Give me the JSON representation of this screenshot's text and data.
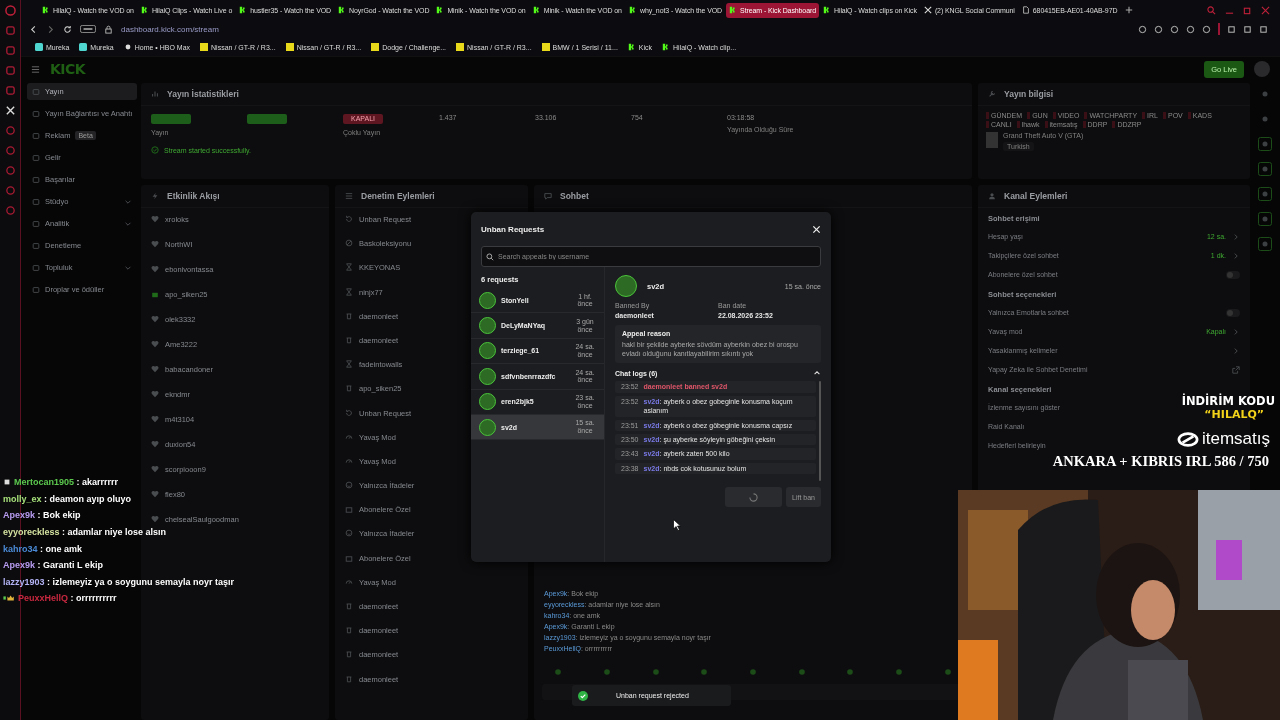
{
  "browser": {
    "tabs": [
      {
        "title": "HilalQ - Watch the VOD on",
        "kind": "kick",
        "selected": false
      },
      {
        "title": "HilalQ Clips - Watch Live o",
        "kind": "kick",
        "selected": false
      },
      {
        "title": "hustler35 - Watch the VOD",
        "kind": "kick",
        "selected": false
      },
      {
        "title": "NoyrGod - Watch the VOD",
        "kind": "kick",
        "selected": false
      },
      {
        "title": "Minik - Watch the VOD on",
        "kind": "kick",
        "selected": false
      },
      {
        "title": "Minik - Watch the VOD on",
        "kind": "kick",
        "selected": false
      },
      {
        "title": "why_not3 - Watch the VOD",
        "kind": "kick",
        "selected": false
      },
      {
        "title": "Stream - Kick Dashboard",
        "kind": "kick",
        "selected": true
      },
      {
        "title": "HilalQ - Watch clips on Kick",
        "kind": "kick",
        "selected": false
      },
      {
        "title": "(2) KNGL Social Communi",
        "kind": "x",
        "selected": false
      },
      {
        "title": "680415EB-AE01-40AB-97D",
        "kind": "file",
        "selected": false
      }
    ],
    "url": "dashboard.kick.com/stream",
    "bookmarks": [
      {
        "label": "Mureka",
        "kind": "mureka"
      },
      {
        "label": "Mureka",
        "kind": "mureka"
      },
      {
        "label": "Home • HBO Max",
        "kind": "dot"
      },
      {
        "label": "Nissan / GT-R / R3...",
        "kind": "s"
      },
      {
        "label": "Nissan / GT-R / R3...",
        "kind": "s"
      },
      {
        "label": "Dodge / Challenge...",
        "kind": "s"
      },
      {
        "label": "Nissan / GT-R / R3...",
        "kind": "s"
      },
      {
        "label": "BMW / 1 Serisi / 11...",
        "kind": "s"
      },
      {
        "label": "Kick",
        "kind": "kick"
      },
      {
        "label": "HilalQ - Watch clip...",
        "kind": "kick"
      }
    ]
  },
  "header": {
    "logo": "KICK",
    "go_live": "Go Live"
  },
  "nav": [
    {
      "label": "Yayın",
      "selected": true,
      "expandable": false
    },
    {
      "label": "Yayın Bağlantısı ve Anahtı",
      "selected": false,
      "expandable": false
    },
    {
      "label": "Reklam",
      "badge": "Beta",
      "selected": false,
      "expandable": false
    },
    {
      "label": "Gelir",
      "selected": false,
      "expandable": false
    },
    {
      "label": "Başarılar",
      "selected": false,
      "expandable": false
    },
    {
      "label": "Stüdyo",
      "selected": false,
      "expandable": true
    },
    {
      "label": "Analitik",
      "selected": false,
      "expandable": true
    },
    {
      "label": "Denetleme",
      "selected": false,
      "expandable": false
    },
    {
      "label": "Topluluk",
      "selected": false,
      "expandable": true
    },
    {
      "label": "Droplar ve ödüller",
      "selected": false,
      "expandable": false
    }
  ],
  "stats": {
    "title": "Yayın İstatistikleri",
    "items": [
      {
        "kind": "badge",
        "color": "#1d5e1a",
        "label": "Yayın"
      },
      {
        "kind": "badge",
        "color": "#1d5e1a"
      },
      {
        "kind": "badge",
        "color": "#5e1620",
        "value": "KAPALI",
        "label": "Çoklu Yayın"
      },
      {
        "kind": "number",
        "value": "1.437"
      },
      {
        "kind": "number",
        "value": "33.106"
      },
      {
        "kind": "number",
        "value": "754"
      },
      {
        "kind": "number",
        "value": "03:18:58",
        "label": "Yayında Olduğu Süre"
      }
    ],
    "status": "Stream started successfully."
  },
  "stream_info": {
    "title": "Yayın bilgisi",
    "tags": [
      "GÜNDEM",
      "GUN",
      "VIDEO",
      "WATCHPARTY",
      "IRL",
      "POV",
      "KADS",
      "CANLI",
      "lhawk",
      "itemsatış",
      "DDRP",
      "DDZRP"
    ],
    "category": "Grand Theft Auto V (GTA)",
    "language": "Turkish"
  },
  "activity": {
    "title": "Etkinlik Akışı",
    "items": [
      {
        "name": "xroloks",
        "kind": "follow"
      },
      {
        "name": "NorthWI",
        "kind": "follow"
      },
      {
        "name": "ebonivontassa",
        "kind": "follow"
      },
      {
        "name": "apo_siken25",
        "kind": "gift"
      },
      {
        "name": "olek3332",
        "kind": "follow"
      },
      {
        "name": "Ame3222",
        "kind": "follow"
      },
      {
        "name": "babacandoner",
        "kind": "follow"
      },
      {
        "name": "ekndmr",
        "kind": "follow"
      },
      {
        "name": "m4t3104",
        "kind": "follow"
      },
      {
        "name": "duxion54",
        "kind": "follow"
      },
      {
        "name": "scorpiooon9",
        "kind": "follow"
      },
      {
        "name": "flex80",
        "kind": "follow"
      },
      {
        "name": "chelsealSaulgoodman",
        "kind": "follow"
      }
    ]
  },
  "moderation": {
    "title": "Denetim Eylemleri",
    "items": [
      {
        "name": "Unban Request",
        "kind": "unban"
      },
      {
        "name": "Baskoleksiyonu",
        "kind": "ban"
      },
      {
        "name": "KKEYONAS",
        "kind": "timeout"
      },
      {
        "name": "ninjx77",
        "kind": "timeout"
      },
      {
        "name": "daemonleet",
        "kind": "delete"
      },
      {
        "name": "daemonleet",
        "kind": "delete"
      },
      {
        "name": "fadeintowalls",
        "kind": "timeout"
      },
      {
        "name": "apo_siken25",
        "kind": "delete"
      },
      {
        "name": "Unban Request",
        "kind": "unban"
      },
      {
        "name": "Yavaş Mod",
        "kind": "slow"
      },
      {
        "name": "Yavaş Mod",
        "kind": "slow"
      },
      {
        "name": "Yalnızca İfadeler",
        "kind": "emote"
      },
      {
        "name": "Abonelere Özel",
        "kind": "subs"
      },
      {
        "name": "Yalnızca İfadeler",
        "kind": "emote"
      },
      {
        "name": "Abonelere Özel",
        "kind": "subs"
      },
      {
        "name": "Yavaş Mod",
        "kind": "slow"
      },
      {
        "name": "daemonleet",
        "kind": "delete"
      },
      {
        "name": "daemonleet",
        "kind": "delete"
      },
      {
        "name": "daemonleet",
        "kind": "delete"
      },
      {
        "name": "daemonleet",
        "kind": "delete"
      }
    ]
  },
  "chat": {
    "title": "Sohbet",
    "messages": [
      {
        "user": "Apex9k",
        "text": ": Bok ekip"
      },
      {
        "user": "eyyoreckless",
        "text": ": adamlar niye lose alsın"
      },
      {
        "user": "kahro34",
        "text": ": one amk"
      },
      {
        "user": "Apex9k",
        "text": ": Garanti L ekip"
      },
      {
        "user": "lazzy1903",
        "text": ": izlemeyiz ya o soygunu semayla noyr taşır"
      },
      {
        "user": "PeuxxHellQ",
        "text": ": orrrrrrrrrr"
      }
    ]
  },
  "channel_actions": {
    "title": "Kanal Eylemleri",
    "sections": [
      {
        "title": "Sohbet erişimi",
        "rows": [
          {
            "label": "Hesap yaşı",
            "kind": "link",
            "value": "12 sa."
          },
          {
            "label": "Takipçilere özel sohbet",
            "kind": "link",
            "value": "1 dk."
          },
          {
            "label": "Abonelere özel sohbet",
            "kind": "toggle",
            "on": false
          }
        ]
      },
      {
        "title": "Sohbet seçenekleri",
        "rows": [
          {
            "label": "Yalnızca Emotlarla sohbet",
            "kind": "toggle",
            "on": false
          },
          {
            "label": "Yavaş mod",
            "kind": "link",
            "value": "Kapalı"
          },
          {
            "label": "Yasaklanmış kelimeler",
            "kind": "link"
          },
          {
            "label": "Yapay Zeka ile Sohbet Denetimi",
            "kind": "external"
          }
        ]
      },
      {
        "title": "Kanal seçenekleri",
        "rows": [
          {
            "label": "İzlenme sayısını göster",
            "kind": "plain"
          },
          {
            "label": "Raid Kanalı",
            "kind": "plain"
          },
          {
            "label": "Hedefleri belirleyin",
            "kind": "plain"
          }
        ]
      }
    ]
  },
  "modal": {
    "title": "Unban Requests",
    "search": {
      "placeholder": "Search appeals by username"
    },
    "count": "6 requests",
    "requests": [
      {
        "name": "StonYell",
        "time": "1 hf. önce",
        "selected": false
      },
      {
        "name": "DeLyMaNYaq",
        "time": "3 gün önce",
        "selected": false
      },
      {
        "name": "terziege_61",
        "time": "24 sa. önce",
        "selected": false
      },
      {
        "name": "sdfvnbenrrazdfc",
        "time": "24 sa. önce",
        "selected": false
      },
      {
        "name": "eren2bjk5",
        "time": "23 sa. önce",
        "selected": false
      },
      {
        "name": "sv2d",
        "time": "15 sa. önce",
        "selected": true
      }
    ],
    "detail": {
      "name": "sv2d",
      "time": "15 sa. önce",
      "banned_by_label": "Banned By",
      "banned_by": "daemonleet",
      "ban_date_label": "Ban date",
      "ban_date": "22.08.2026 23:52",
      "appeal_title": "Appeal reason",
      "appeal": "hakl bir şekilde ayberke sövdüm ayberkin obez bi orospu evladı olduğunu kanıtlayabilirim sıkıntı yok",
      "logs_title": "Chat logs (6)",
      "logs_expanded": true,
      "logs": [
        {
          "time": "23:52",
          "kind": "ban",
          "text": "daemonleet banned sv2d"
        },
        {
          "time": "23:52",
          "kind": "message",
          "user": "sv2d",
          "text": ": ayberk o obez gobeginle konusma koçum aslanım"
        },
        {
          "time": "23:51",
          "kind": "message",
          "user": "sv2d",
          "text": ": ayberk o obez göbeginle konusma capsız"
        },
        {
          "time": "23:50",
          "kind": "message",
          "user": "sv2d",
          "text": ": şu ayberke söyleyin göbeğini çeksin"
        },
        {
          "time": "23:43",
          "kind": "message",
          "user": "sv2d",
          "text": ": ayberk zaten 500 kilo"
        },
        {
          "time": "23:38",
          "kind": "message",
          "user": "sv2d",
          "text": ": nbds cok kotusunuz bolum"
        }
      ]
    },
    "lift_ban": "Lift ban",
    "loading": true
  },
  "toast": "Unban request rejected",
  "overlay_chat": [
    {
      "user": "Mertocan1905",
      "text": ": akarrrrrr",
      "color": "#5cc94e",
      "kind": "mod"
    },
    {
      "user": "molly_ex",
      "text": ": deamon ayıp oluyo",
      "color": "#a6e07a",
      "kind": "plain"
    },
    {
      "user": "Apex9k",
      "text": ": Bok ekip",
      "color": "#b79cf0",
      "kind": "plain"
    },
    {
      "user": "eyyoreckless",
      "text": ": adamlar niye lose alsın",
      "color": "#d5e3a0",
      "kind": "plain"
    },
    {
      "user": "kahro34",
      "text": ": one amk",
      "color": "#4a8ad6",
      "kind": "plain"
    },
    {
      "user": "Apex9k",
      "text": ": Garanti L ekip",
      "color": "#b79cf0",
      "kind": "plain"
    },
    {
      "user": "lazzy1903",
      "text": ": izlemeyiz ya o soygunu semayla noyr taşır",
      "color": "#b3b3f5",
      "kind": "plain"
    },
    {
      "user": "PeuxxHellQ",
      "text": ": orrrrrrrrrr",
      "color": "#c8283f",
      "kind": "crown"
    }
  ],
  "promo": {
    "line1": "İNDİRİM KODU",
    "code": "“HILALQ”",
    "brand": "itemsatış",
    "goal": "ANKARA + KIBRIS IRL 586 / 750"
  }
}
